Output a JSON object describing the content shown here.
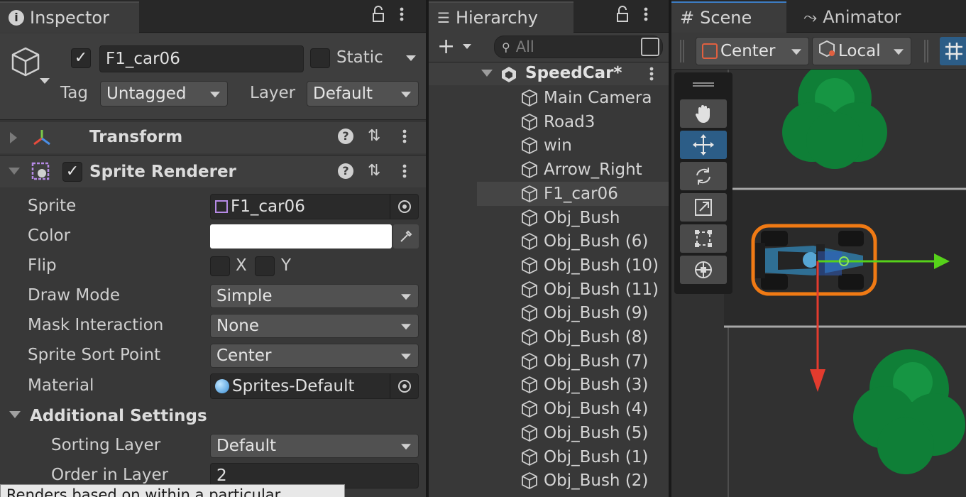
{
  "inspector": {
    "tab_label": "Inspector",
    "object_name": "F1_car06",
    "static_label": "Static",
    "tag_label": "Tag",
    "tag_value": "Untagged",
    "layer_label": "Layer",
    "layer_value": "Default",
    "transform_title": "Transform",
    "sprite_renderer_title": "Sprite Renderer",
    "fields": {
      "sprite_label": "Sprite",
      "sprite_value": "F1_car06",
      "color_label": "Color",
      "flip_label": "Flip",
      "flip_x": "X",
      "flip_y": "Y",
      "draw_mode_label": "Draw Mode",
      "draw_mode_value": "Simple",
      "mask_interaction_label": "Mask Interaction",
      "mask_interaction_value": "None",
      "sort_point_label": "Sprite Sort Point",
      "sort_point_value": "Center",
      "material_label": "Material",
      "material_value": "Sprites-Default",
      "additional_settings": "Additional Settings",
      "sorting_layer_label": "Sorting Layer",
      "sorting_layer_value": "Default",
      "order_label": "Order in Layer",
      "order_value": "2"
    },
    "tooltip_text": "Renders based on within a particular"
  },
  "hierarchy": {
    "tab_label": "Hierarchy",
    "search_placeholder": "All",
    "scene_name": "SpeedCar*",
    "items": [
      {
        "label": "Main Camera"
      },
      {
        "label": "Road3"
      },
      {
        "label": "win"
      },
      {
        "label": "Arrow_Right"
      },
      {
        "label": "F1_car06"
      },
      {
        "label": "Obj_Bush"
      },
      {
        "label": "Obj_Bush (6)"
      },
      {
        "label": "Obj_Bush (10)"
      },
      {
        "label": "Obj_Bush (11)"
      },
      {
        "label": "Obj_Bush (9)"
      },
      {
        "label": "Obj_Bush (8)"
      },
      {
        "label": "Obj_Bush (7)"
      },
      {
        "label": "Obj_Bush (3)"
      },
      {
        "label": "Obj_Bush (4)"
      },
      {
        "label": "Obj_Bush (5)"
      },
      {
        "label": "Obj_Bush (1)"
      },
      {
        "label": "Obj_Bush (2)"
      }
    ],
    "selected_index": 4
  },
  "scene": {
    "tab_label": "Scene",
    "animator_tab_label": "Animator",
    "pivot_label": "Center",
    "space_label": "Local",
    "tools": [
      "hand-tool",
      "move-tool",
      "rotate-tool",
      "scale-tool",
      "rect-tool",
      "transform-tool"
    ],
    "active_tool": "move-tool"
  },
  "colors": {
    "panel_bg": "#383838",
    "selection": "#2c5d87",
    "bush": "#0f8a3c",
    "gizmo_x": "#e23b2e",
    "gizmo_y": "#56d11a",
    "outline": "#f07a14"
  }
}
